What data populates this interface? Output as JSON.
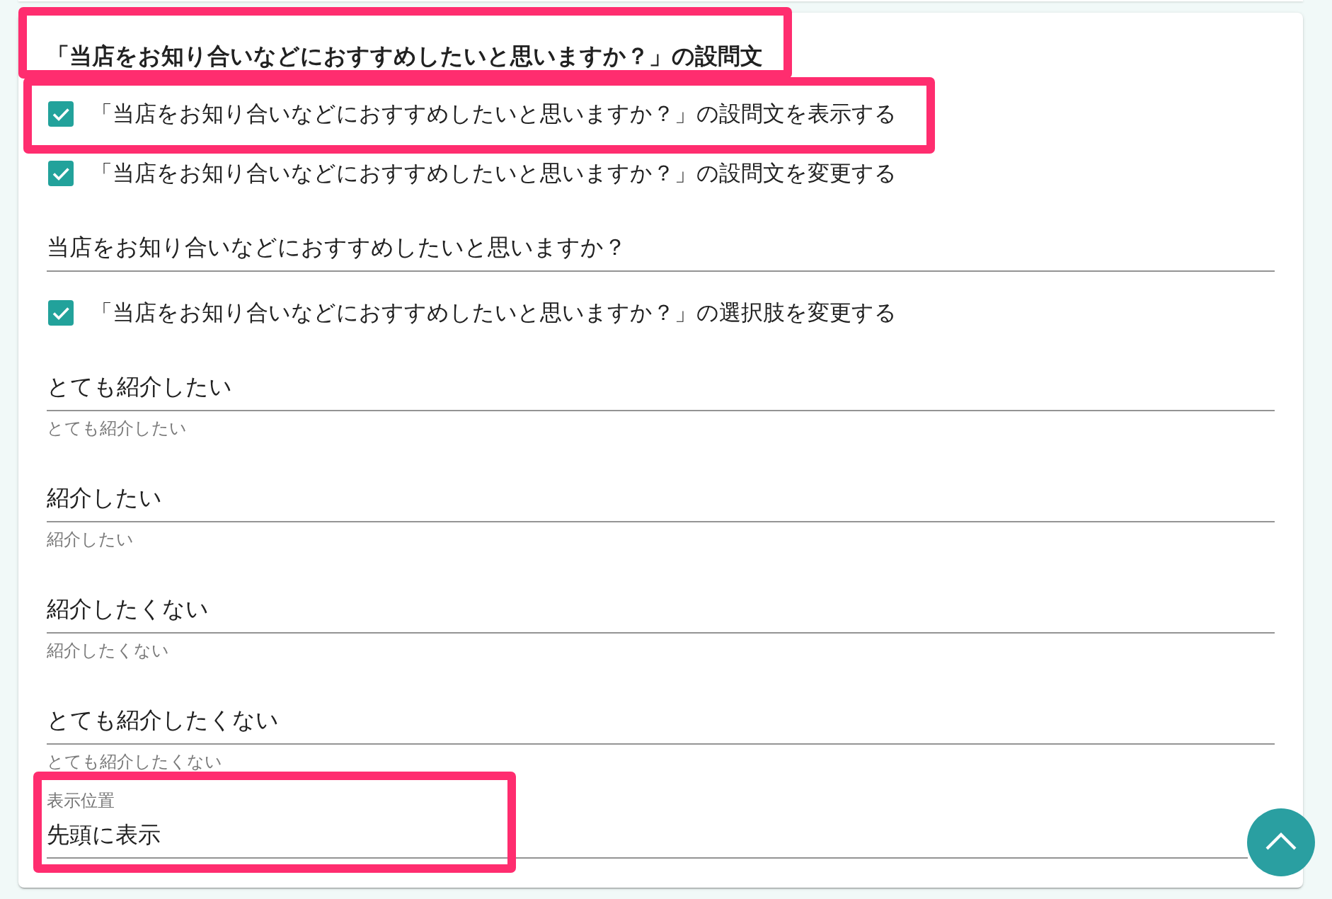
{
  "question_section": {
    "heading": {
      "text": "「当店をお知り合いなどにおすすめしたいと思いますか？」の設問文",
      "highlighted": true
    },
    "items": [
      {
        "kind": "checkbox",
        "label": "「当店をお知り合いなどにおすすめしたいと思いますか？」の設問文を表示する",
        "checked": true,
        "highlighted": true
      },
      {
        "kind": "checkbox",
        "label": "「当店をお知り合いなどにおすすめしたいと思いますか？」の設問文を変更する",
        "checked": true,
        "highlighted": false
      },
      {
        "kind": "text_field",
        "value": "当店をお知り合いなどにおすすめしたいと思いますか？",
        "highlighted": false
      },
      {
        "kind": "checkbox",
        "label": "「当店をお知り合いなどにおすすめしたいと思いますか？」の選択肢を変更する",
        "checked": true,
        "highlighted": false
      },
      {
        "kind": "text_field",
        "value": "とても紹介したい",
        "hint": "とても紹介したい",
        "highlighted": false
      },
      {
        "kind": "text_field",
        "value": "紹介したい",
        "hint": "紹介したい",
        "highlighted": false
      },
      {
        "kind": "text_field",
        "value": "紹介したくない",
        "hint": "紹介したくない",
        "highlighted": false
      },
      {
        "kind": "text_field",
        "value": "とても紹介したくない",
        "hint": "とても紹介したくない",
        "highlighted": false
      },
      {
        "kind": "select",
        "label": "表示位置",
        "value": "先頭に表示",
        "highlighted": true
      }
    ]
  }
}
